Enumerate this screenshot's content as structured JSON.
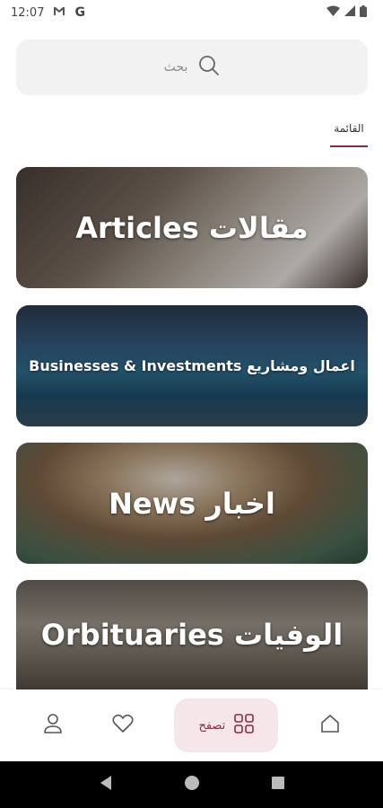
{
  "status": {
    "time": "12:07",
    "g_label": "G"
  },
  "search": {
    "placeholder": "بحث"
  },
  "tab": {
    "label": "القائمة"
  },
  "cards": [
    {
      "label": "Articles مقالات"
    },
    {
      "label": "Businesses & Investments اعمال ومشاريع"
    },
    {
      "label": "News اخبار"
    },
    {
      "label": "Orbituaries الوفيات"
    }
  ],
  "nav": {
    "browse_label": "تصفح"
  },
  "colors": {
    "accent": "#8b2c44",
    "accent_bg": "#f4e6e9",
    "search_bg": "#f3f2f2"
  }
}
